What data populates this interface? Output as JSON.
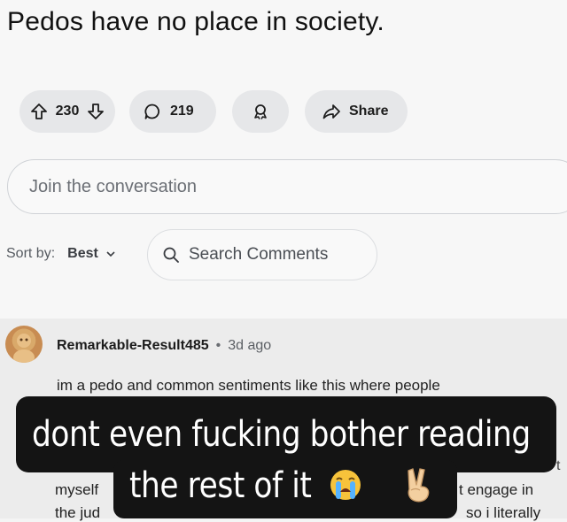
{
  "post": {
    "title": "Pedos have no place in society."
  },
  "actions": {
    "upvotes": "230",
    "comments": "219",
    "share_label": "Share"
  },
  "join": {
    "placeholder": "Join the conversation"
  },
  "sort": {
    "label": "Sort by:",
    "value": "Best"
  },
  "search": {
    "label": "Search Comments"
  },
  "comment": {
    "author": "Remarkable-Result485",
    "separator": "•",
    "time": "3d ago",
    "line1": "im a pedo and common sentiments like this where people",
    "frag_left1": "myself",
    "frag_left2": "the jud",
    "frag_right1": "t engage in",
    "frag_right2": "so i literally",
    "frag_edge": "t"
  },
  "caption": {
    "line1": "dont even fucking bother reading",
    "line2": "the rest of it"
  },
  "icons": {
    "upvote": "arrow-up-icon",
    "downvote": "arrow-down-icon",
    "comment": "speech-bubble-icon",
    "award": "award-icon",
    "share": "share-arrow-icon",
    "search": "search-icon",
    "chevron": "chevron-down-icon",
    "crying": "loudly-crying-emoji",
    "victory": "victory-hand-emoji"
  }
}
